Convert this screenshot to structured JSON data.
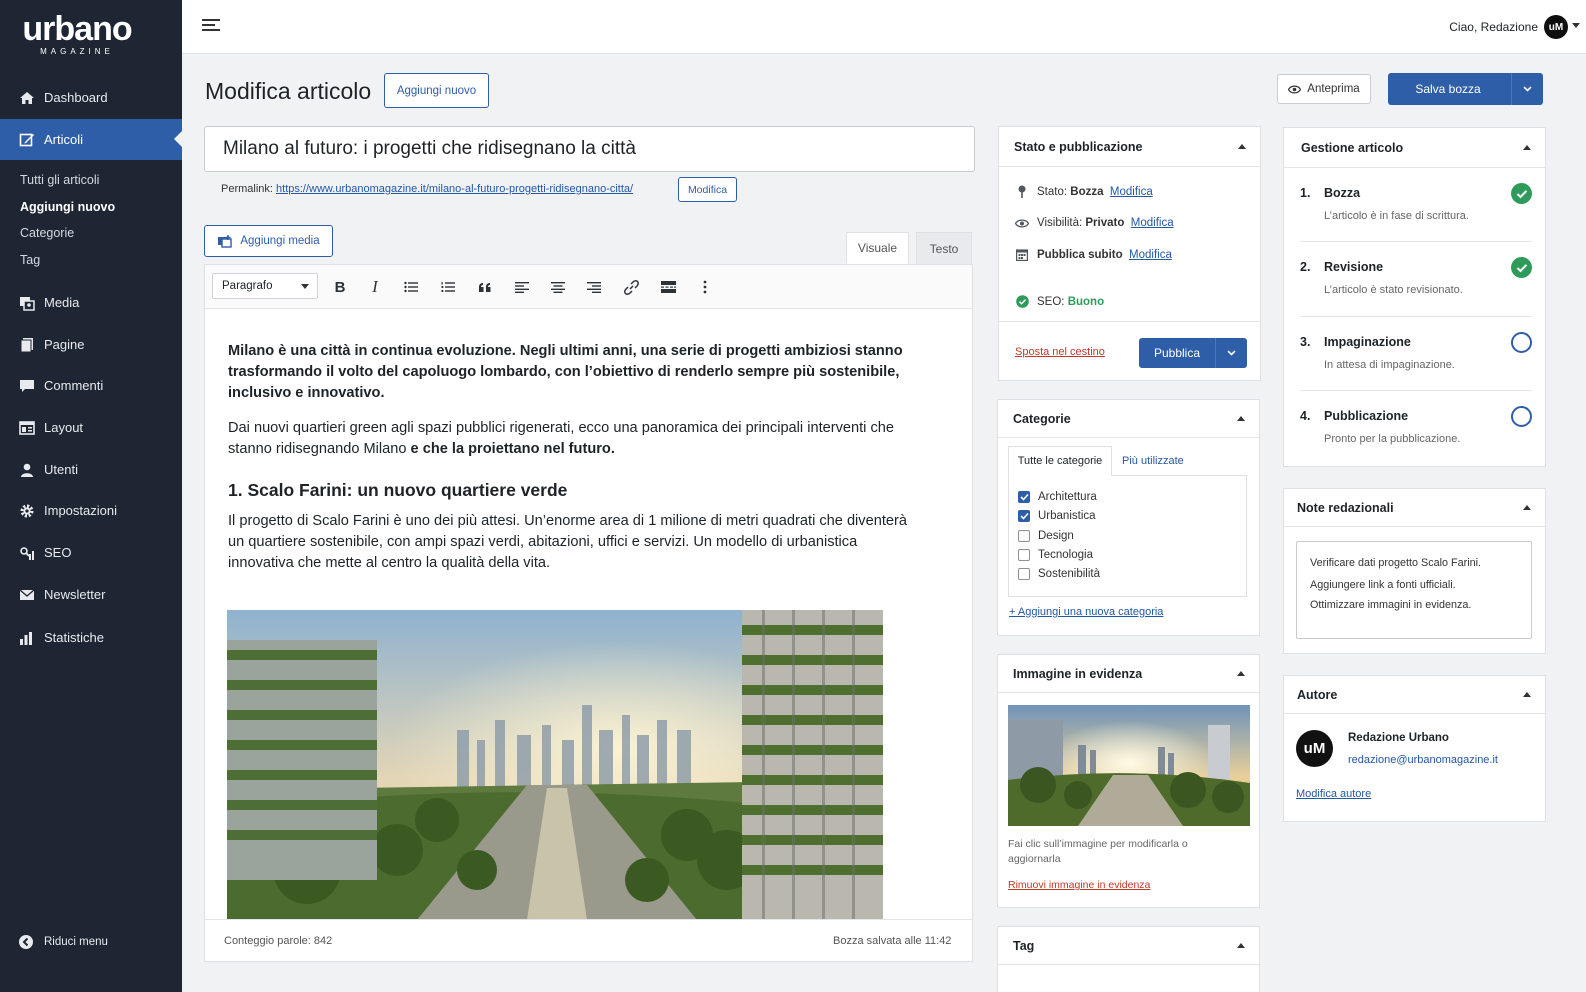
{
  "brand": {
    "name": "urbano",
    "sub": "MAGAZINE"
  },
  "sidebar": {
    "items": [
      {
        "label": "Dashboard",
        "icon": "home-icon"
      },
      {
        "label": "Articoli",
        "icon": "edit-icon"
      },
      {
        "label": "Media",
        "icon": "media-icon"
      },
      {
        "label": "Pagine",
        "icon": "pages-icon"
      },
      {
        "label": "Commenti",
        "icon": "comment-icon"
      },
      {
        "label": "Layout",
        "icon": "layout-icon"
      },
      {
        "label": "Utenti",
        "icon": "user-icon"
      },
      {
        "label": "Impostazioni",
        "icon": "gear-icon"
      },
      {
        "label": "SEO",
        "icon": "seo-icon"
      },
      {
        "label": "Newsletter",
        "icon": "mail-icon"
      },
      {
        "label": "Statistiche",
        "icon": "chart-icon"
      }
    ],
    "sub_items": [
      "Tutti gli articoli",
      "Aggiungi nuovo",
      "Categorie",
      "Tag"
    ],
    "collapse_label": "Riduci menu"
  },
  "topbar": {
    "greeting": "Ciao, Redazione",
    "avatar_initials": "uM"
  },
  "header": {
    "title": "Modifica articolo",
    "add_new": "Aggiungi nuovo",
    "preview": "Anteprima",
    "save_draft": "Salva bozza"
  },
  "post": {
    "title": "Milano al futuro: i progetti che ridisegnano la città",
    "permalink_label": "Permalink:",
    "permalink_url": "https://www.urbanomagazine.it/milano-al-futuro-progetti-ridisegnano-citta/",
    "permalink_edit": "Modifica"
  },
  "editor": {
    "add_media": "Aggiungi media",
    "tab_visual": "Visuale",
    "tab_text": "Testo",
    "format": "Paragrafo",
    "p1": "Milano è una città in continua evoluzione. Negli ultimi anni, una serie di progetti ambiziosi stanno trasformando il volto del capoluogo lombardo, con l’obiettivo di renderlo sempre più sostenibile, inclusivo e innovativo.",
    "p2_a": "Dai nuovi quartieri green agli spazi pubblici rigenerati, ecco una panoramica dei principali interventi che stanno ridisegnando Milano ",
    "p2_b": "e che la proiettano nel futuro.",
    "h1": "1. Scalo Farini: un nuovo quartiere verde",
    "p3": "Il progetto di Scalo Farini è uno dei più attesi. Un’enorme area di 1 milione di metri quadrati che diventerà un quartiere sostenibile, con ampi spazi verdi, abitazioni, uffici e servizi. Un modello di urbanistica innovativa che mette al centro la qualità della vita.",
    "word_count": "Conteggio parole: 842",
    "saved": "Bozza salvata alle 11:42"
  },
  "publish": {
    "title": "Stato e pubblicazione",
    "status_label": "Stato:",
    "status_value": "Bozza",
    "visibility_label": "Visibilità:",
    "visibility_value": "Privato",
    "schedule_value": "Pubblica subito",
    "edit": "Modifica",
    "seo_label": "SEO:",
    "seo_value": "Buono",
    "trash": "Sposta nel cestino",
    "publish_btn": "Pubblica"
  },
  "categories": {
    "title": "Categorie",
    "tab_all": "Tutte le categorie",
    "tab_popular": "Più utilizzate",
    "items": [
      {
        "label": "Architettura",
        "checked": true
      },
      {
        "label": "Urbanistica",
        "checked": true
      },
      {
        "label": "Design",
        "checked": false
      },
      {
        "label": "Tecnologia",
        "checked": false
      },
      {
        "label": "Sostenibilità",
        "checked": false
      }
    ],
    "add_new": "+ Aggiungi una nuova categoria"
  },
  "featured": {
    "title": "Immagine in evidenza",
    "caption": "Fai clic sull’immagine per modificarla o aggiornarla",
    "remove": "Rimuovi immagine in evidenza"
  },
  "tags": {
    "title": "Tag"
  },
  "workflow": {
    "title": "Gestione articolo",
    "steps": [
      {
        "num": "1.",
        "title": "Bozza",
        "desc": "L’articolo è in fase di scrittura.",
        "done": true
      },
      {
        "num": "2.",
        "title": "Revisione",
        "desc": "L’articolo è stato revisionato.",
        "done": true
      },
      {
        "num": "3.",
        "title": "Impaginazione",
        "desc": "In attesa di impaginazione.",
        "done": false
      },
      {
        "num": "4.",
        "title": "Pubblicazione",
        "desc": "Pronto per la pubblicazione.",
        "done": false
      }
    ]
  },
  "notes": {
    "title": "Note redazionali",
    "lines": [
      "Verificare dati progetto Scalo Farini.",
      "Aggiungere link a fonti ufficiali.",
      "Ottimizzare immagini in evidenza."
    ]
  },
  "author": {
    "title": "Autore",
    "name": "Redazione Urbano",
    "email": "redazione@urbanomagazine.it",
    "edit": "Modifica autore",
    "initials": "uM"
  },
  "colors": {
    "sidebar": "#1e2633",
    "accent": "#2f5ea8",
    "success": "#2f9b5a",
    "danger": "#c0392b"
  }
}
